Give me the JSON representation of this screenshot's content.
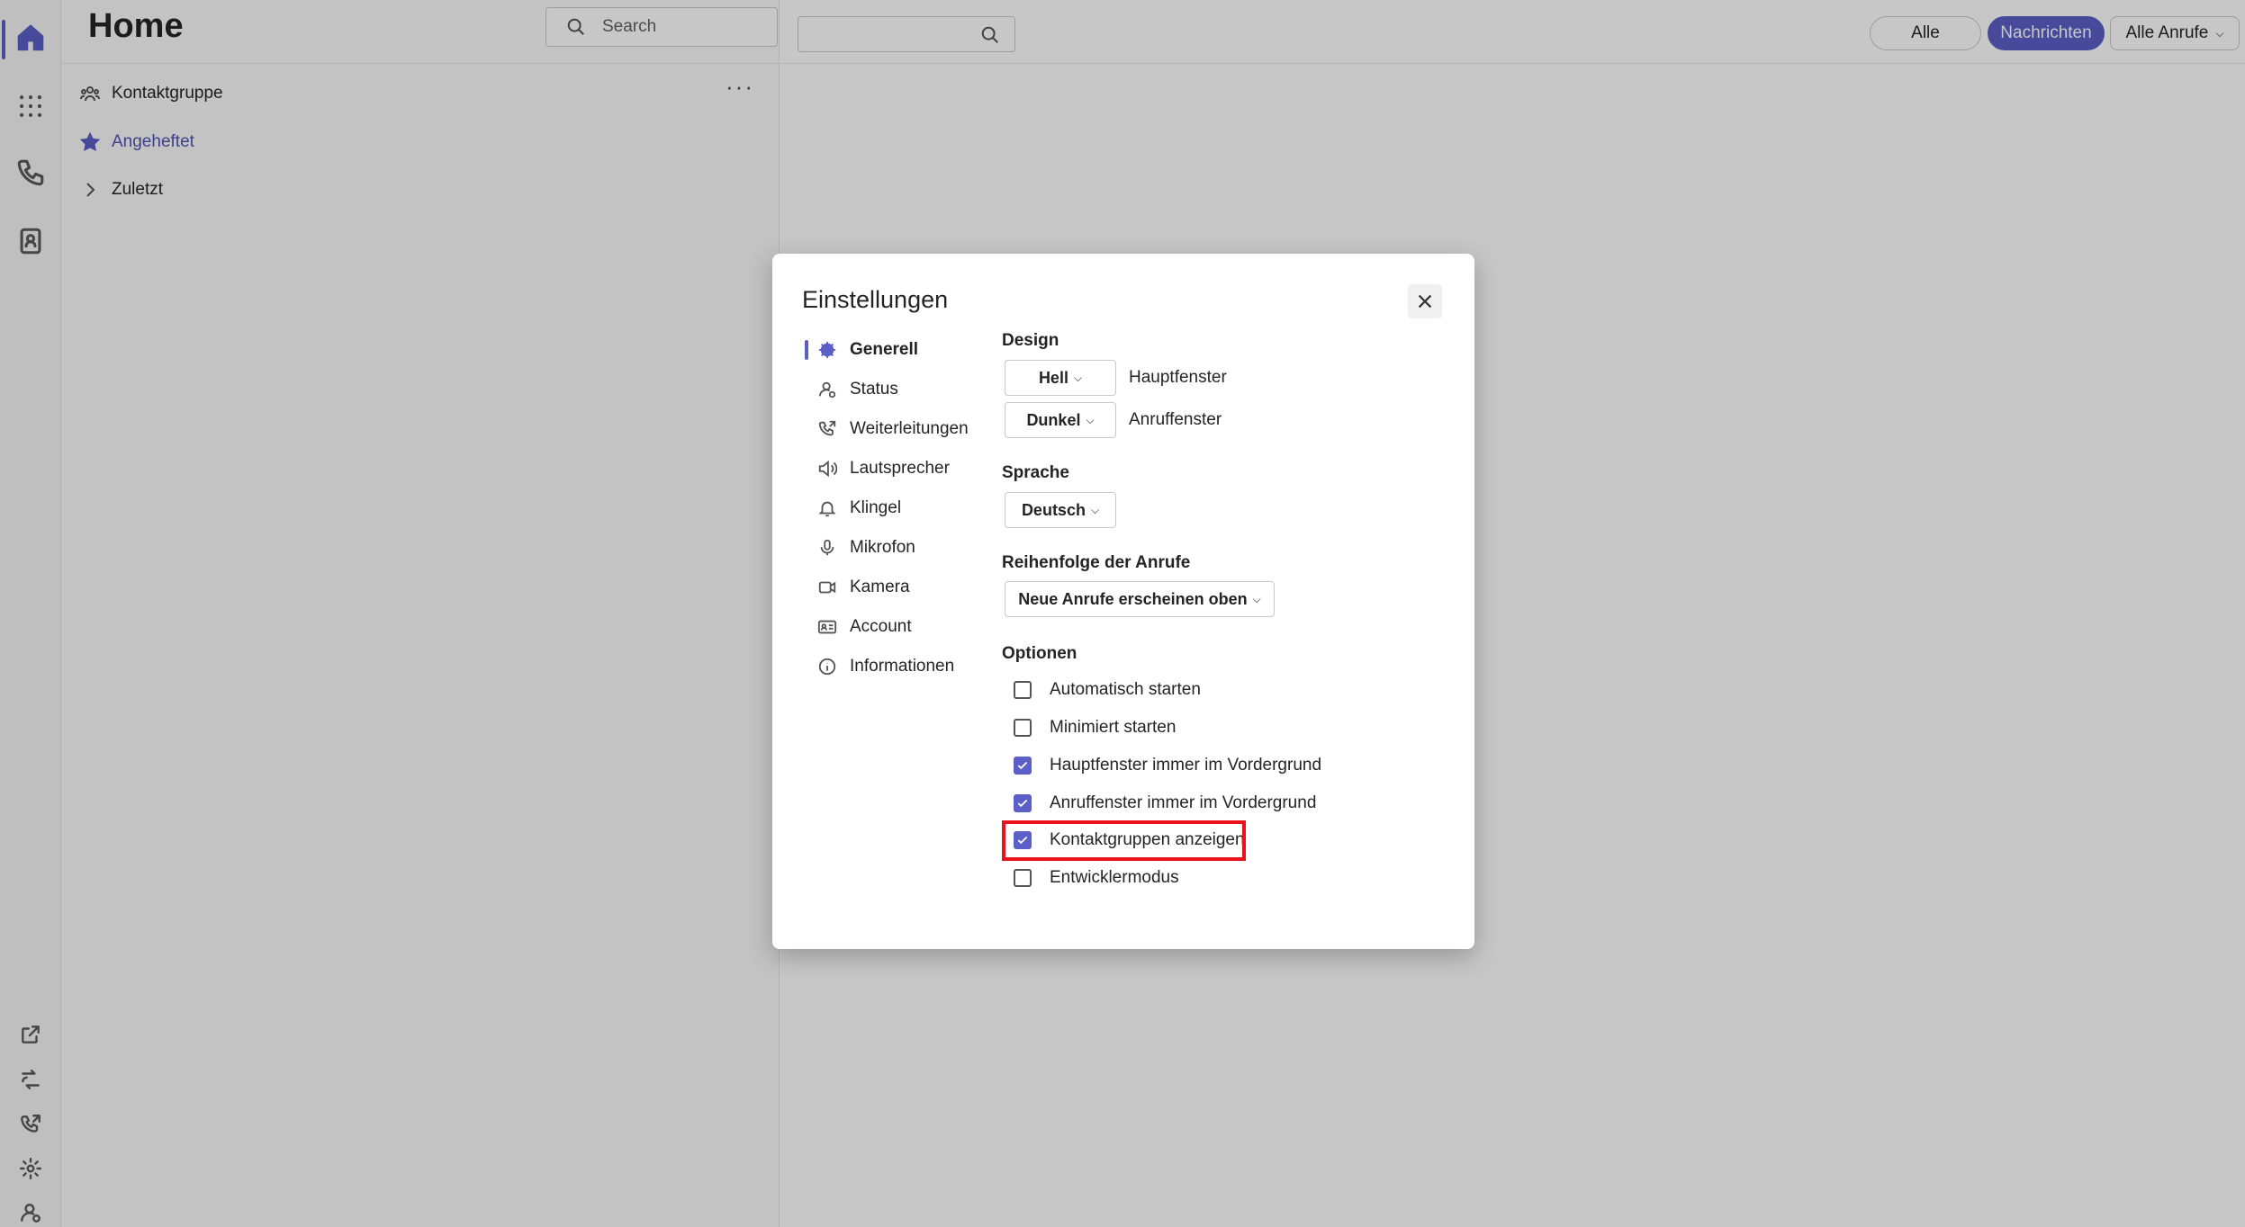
{
  "app": {
    "page_title": "Home",
    "search_placeholder": "Search"
  },
  "sidebar": {
    "tree": [
      {
        "label": "Kontaktgruppe",
        "icon": "group-icon"
      },
      {
        "label": "Angeheftet",
        "icon": "star-icon"
      },
      {
        "label": "Zuletzt",
        "icon": "chevron-right-icon"
      }
    ],
    "more_label": "···"
  },
  "filters": {
    "all": "Alle",
    "messages": "Nachrichten",
    "calls": "Alle Anrufe"
  },
  "dialog": {
    "title": "Einstellungen",
    "nav": [
      {
        "label": "Generell",
        "icon": "gear-icon"
      },
      {
        "label": "Status",
        "icon": "person-status-icon"
      },
      {
        "label": "Weiterleitungen",
        "icon": "call-forward-icon"
      },
      {
        "label": "Lautsprecher",
        "icon": "speaker-icon"
      },
      {
        "label": "Klingel",
        "icon": "bell-icon"
      },
      {
        "label": "Mikrofon",
        "icon": "microphone-icon"
      },
      {
        "label": "Kamera",
        "icon": "camera-icon"
      },
      {
        "label": "Account",
        "icon": "contact-card-icon"
      },
      {
        "label": "Informationen",
        "icon": "info-icon"
      }
    ],
    "design": {
      "heading": "Design",
      "main_value": "Hell",
      "main_label": "Hauptfenster",
      "call_value": "Dunkel",
      "call_label": "Anruffenster"
    },
    "language": {
      "heading": "Sprache",
      "value": "Deutsch"
    },
    "order": {
      "heading": "Reihenfolge der Anrufe",
      "value": "Neue Anrufe erscheinen oben"
    },
    "options": {
      "heading": "Optionen",
      "items": [
        {
          "label": "Automatisch starten",
          "checked": false
        },
        {
          "label": "Minimiert starten",
          "checked": false
        },
        {
          "label": "Hauptfenster immer im Vordergrund",
          "checked": true
        },
        {
          "label": "Anruffenster immer im Vordergrund",
          "checked": true
        },
        {
          "label": "Kontaktgruppen anzeigen",
          "checked": true
        },
        {
          "label": "Entwicklermodus",
          "checked": false
        }
      ]
    }
  },
  "colors": {
    "accent": "#5b5fc7",
    "highlight": "#e8131d"
  }
}
